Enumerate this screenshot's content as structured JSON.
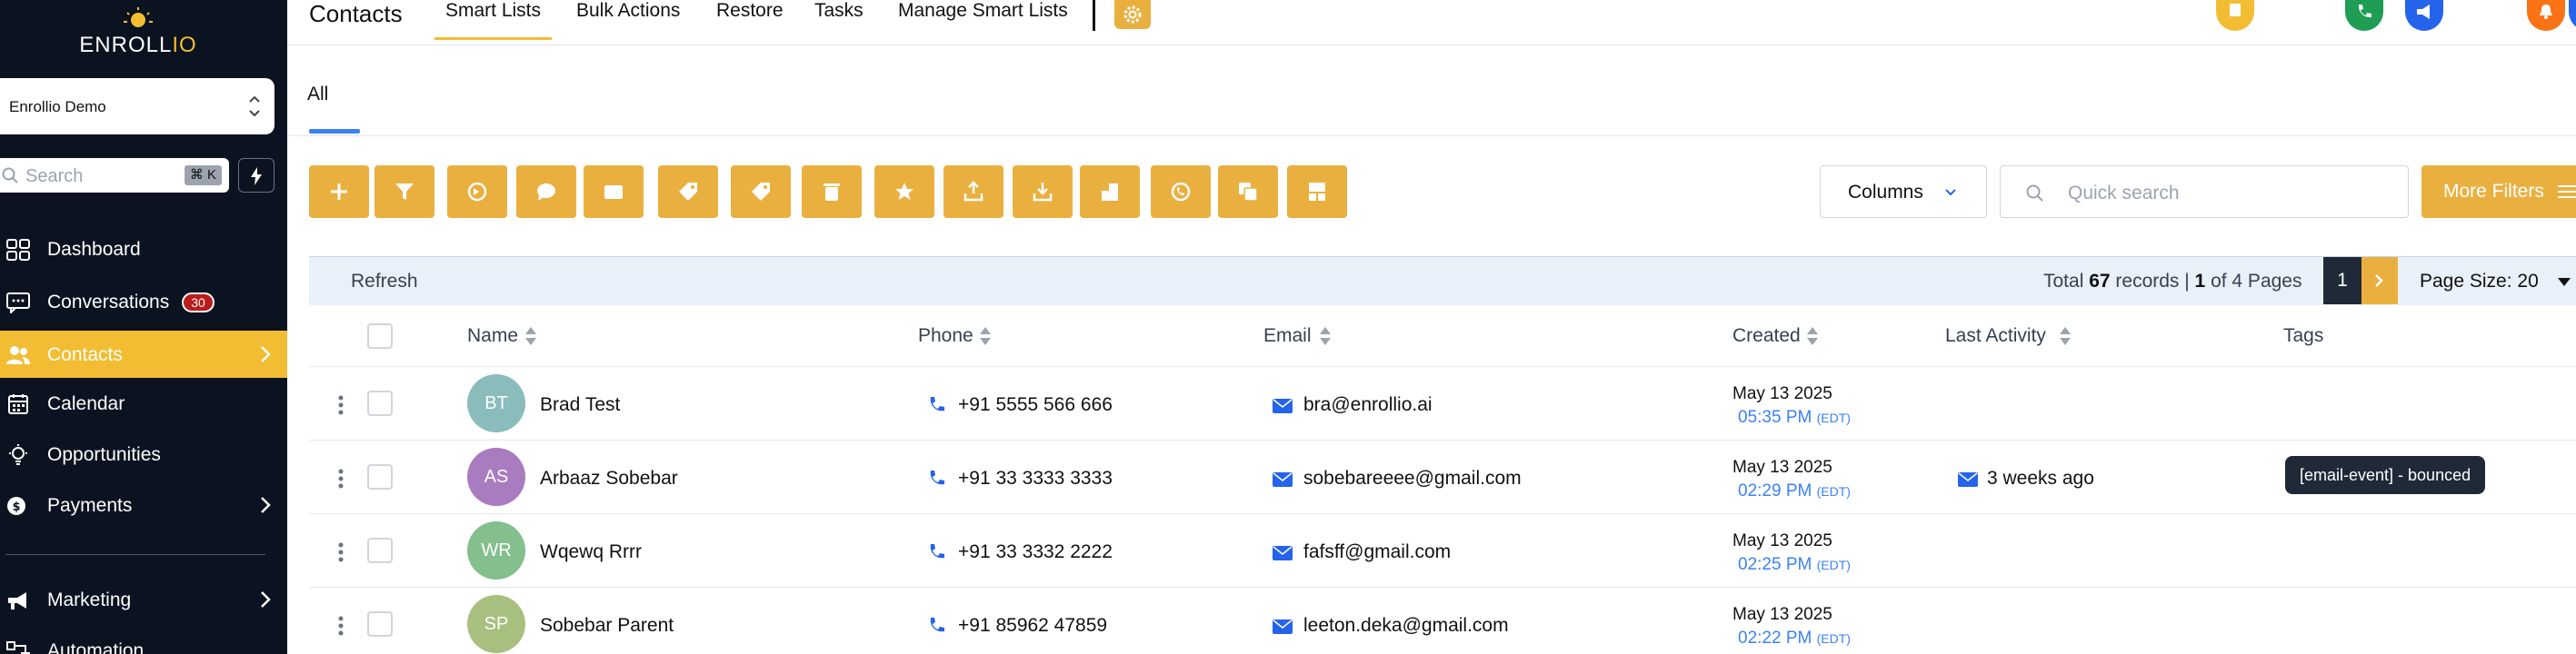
{
  "brand": {
    "logo_text_a": "ENROLL",
    "logo_text_b": "IO"
  },
  "account": {
    "name": "Enrollio Demo"
  },
  "sidebar_search": {
    "placeholder": "Search",
    "shortcut": "⌘ K"
  },
  "nav": {
    "dashboard": "Dashboard",
    "conversations": "Conversations",
    "conversations_badge": "30",
    "contacts": "Contacts",
    "calendar": "Calendar",
    "opportunities": "Opportunities",
    "payments": "Payments",
    "marketing": "Marketing",
    "automation": "Automation"
  },
  "topnav": {
    "title": "Contacts",
    "items": [
      "Smart Lists",
      "Bulk Actions",
      "Restore",
      "Tasks",
      "Manage Smart Lists"
    ]
  },
  "tabs": {
    "all": "All"
  },
  "toolbar": {
    "columns_label": "Columns",
    "quick_search_placeholder": "Quick search",
    "more_filters_label": "More Filters",
    "icons": [
      "plus-icon",
      "filter-icon",
      "workflow-icon",
      "message-icon",
      "email-icon",
      "tag-add-icon",
      "tag-remove-icon",
      "trash-icon",
      "star-icon",
      "export-icon",
      "import-icon",
      "company-icon",
      "whatsapp-icon",
      "duplicate-icon",
      "bulk-actions-icon"
    ]
  },
  "info": {
    "refresh": "Refresh",
    "total_prefix": "Total ",
    "total_records": "67",
    "records_mid": " records | ",
    "current_page": "1",
    "pages_suffix": " of 4 Pages",
    "page_button": "1",
    "page_size_label": "Page Size: 20"
  },
  "table": {
    "headers": {
      "name": "Name",
      "phone": "Phone",
      "email": "Email",
      "created": "Created",
      "last_activity": "Last Activity",
      "tags": "Tags"
    },
    "rows": [
      {
        "initials": "BT",
        "avatar_color": "#8bbcbc",
        "name": "Brad Test",
        "phone": "+91 5555 566 666",
        "email": "bra@enrollio.ai",
        "date": "May 13 2025",
        "time": "05:35 PM",
        "tz": "(EDT)",
        "activity": "",
        "tag": ""
      },
      {
        "initials": "AS",
        "avatar_color": "#a97bbf",
        "name": "Arbaaz Sobebar",
        "phone": "+91 33 3333 3333",
        "email": "sobebareeee@gmail.com",
        "date": "May 13 2025",
        "time": "02:29 PM",
        "tz": "(EDT)",
        "activity": "3 weeks ago",
        "tag": "[email-event] - bounced"
      },
      {
        "initials": "WR",
        "avatar_color": "#84bf8e",
        "name": "Wqewq Rrrr",
        "phone": "+91 33 3332 2222",
        "email": "fafsff@gmail.com",
        "date": "May 13 2025",
        "time": "02:25 PM",
        "tz": "(EDT)",
        "activity": "",
        "tag": ""
      },
      {
        "initials": "SP",
        "avatar_color": "#a8c07f",
        "name": "Sobebar Parent",
        "phone": "+91 85962 47859",
        "email": "leeton.deka@gmail.com",
        "date": "May 13 2025",
        "time": "02:22 PM",
        "tz": "(EDT)",
        "activity": "",
        "tag": ""
      }
    ]
  },
  "colors": {
    "accent": "#eab03f",
    "sidebar": "#0b1220",
    "link": "#3b82f6"
  }
}
